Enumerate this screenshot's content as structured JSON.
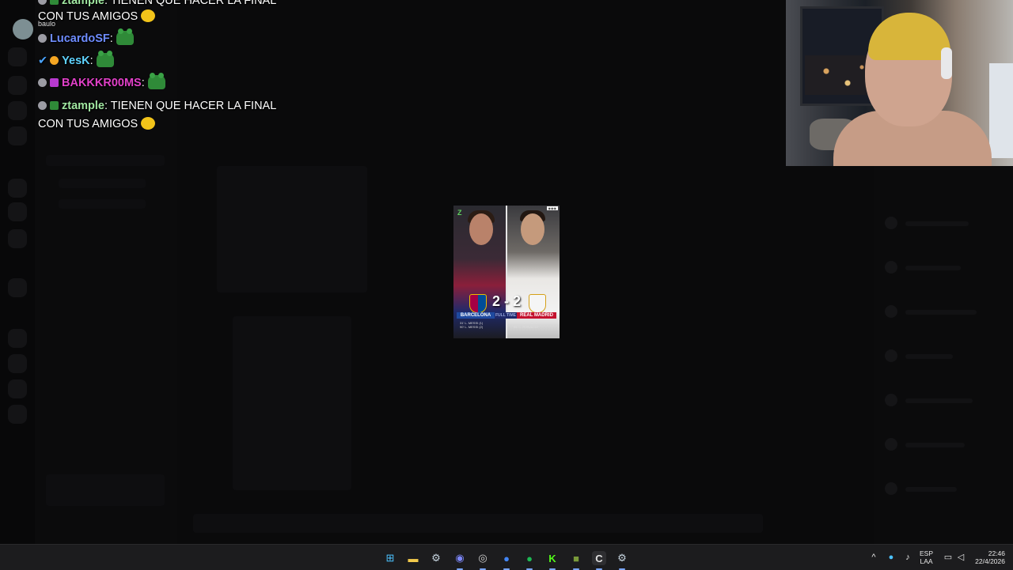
{
  "chat": {
    "partial_top": {
      "user": "ztample",
      "text": ": TIENEN QUE HACER LA FINAL",
      "continuation": "CON TUS AMIGOS"
    },
    "overlap_name": "baulo",
    "messages": [
      {
        "user": "LucardoSF",
        "color": "#6e8cff",
        "text": ":"
      },
      {
        "user": "YesK",
        "color": "#5fd3ff",
        "text": ":"
      },
      {
        "user": "BAKKKR00MS",
        "color": "#e040c8",
        "text": ":"
      },
      {
        "user": "ztample",
        "color": "#9fe6a0",
        "text": ": TIENEN QUE HACER LA FINAL",
        "continuation": "CON TUS AMIGOS"
      }
    ]
  },
  "webcam": {
    "label": "streamer webcam"
  },
  "poster": {
    "score": "2 - 2",
    "home_team": "BARCELONA",
    "away_team": "REAL MADRID",
    "status": "FULL TIME",
    "home_scorers": [
      "31'  L. MESSI (1)",
      "90'  L. MESSI (2)"
    ],
    "away_scorers": [
      "22'  C. RONALDO",
      "66'  C. RONALDO"
    ]
  },
  "taskbar": {
    "apps": [
      {
        "name": "windows-start",
        "glyph": "⊞",
        "color": "#4cc2ff"
      },
      {
        "name": "file-explorer",
        "glyph": "▬",
        "color": "#f2c94c"
      },
      {
        "name": "steam",
        "glyph": "⚙",
        "color": "#c7d5e0"
      },
      {
        "name": "discord",
        "glyph": "◉",
        "color": "#7c86f8"
      },
      {
        "name": "obs",
        "glyph": "◎",
        "color": "#d0d0d0"
      },
      {
        "name": "chrome",
        "glyph": "●",
        "color": "#4285f4"
      },
      {
        "name": "spotify",
        "glyph": "●",
        "color": "#1db954"
      },
      {
        "name": "kick",
        "glyph": "K",
        "color": "#53fc18"
      },
      {
        "name": "minecraft",
        "glyph": "■",
        "color": "#7a9a3a"
      },
      {
        "name": "app-c",
        "glyph": "C",
        "color": "#e0e0e0"
      },
      {
        "name": "steam-2",
        "glyph": "⚙",
        "color": "#c7d5e0"
      }
    ],
    "language": "ESP",
    "layout": "LAA",
    "time": "22:46",
    "date": "22/4/2026"
  }
}
